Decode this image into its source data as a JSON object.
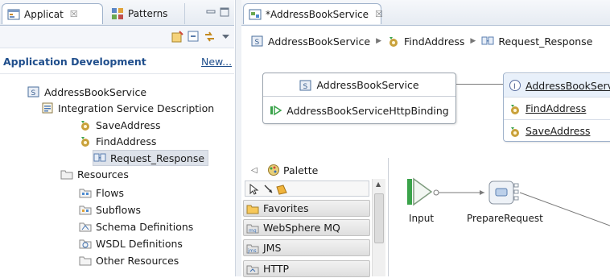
{
  "left_view": {
    "tabs": [
      {
        "label": "Applicat",
        "close": "☒"
      },
      {
        "label": "Patterns"
      }
    ],
    "header": {
      "title": "Application Development",
      "new_link": "New..."
    },
    "tree": [
      {
        "label": "AddressBookService"
      },
      {
        "label": "Integration Service Description"
      },
      {
        "label": "SaveAddress"
      },
      {
        "label": "FindAddress"
      },
      {
        "label": "Request_Response"
      },
      {
        "label": "Resources"
      },
      {
        "label": "Flows"
      },
      {
        "label": "Subflows"
      },
      {
        "label": "Schema Definitions"
      },
      {
        "label": "WSDL Definitions"
      },
      {
        "label": "Other Resources"
      }
    ]
  },
  "editor": {
    "tab": {
      "label": "*AddressBookService",
      "close": "☒"
    },
    "breadcrumb": [
      "AddressBookService",
      "FindAddress",
      "Request_Response"
    ],
    "service_box": {
      "title": "AddressBookService",
      "binding": "AddressBookServiceHttpBinding"
    },
    "interface_box": {
      "title": "AddressBookServ",
      "operations": [
        "FindAddress",
        "SaveAddress"
      ]
    },
    "palette": {
      "title": "Palette",
      "drawers": [
        "Favorites",
        "WebSphere MQ",
        "JMS",
        "HTTP"
      ]
    },
    "canvas": {
      "nodes": [
        {
          "label": "Input"
        },
        {
          "label": "PrepareRequest"
        }
      ]
    }
  },
  "colors": {
    "tab_border": "#9fb2cb",
    "header_blue": "#1f4e8c",
    "selection": "#dde2ea",
    "node_green": "#3aa34a"
  },
  "icons": {
    "service": "service-icon",
    "isd": "isd-icon",
    "operation": "gear-operation-icon",
    "request_response": "request-response-icon",
    "folder": "folder-icon",
    "interface": "interface-icon"
  }
}
